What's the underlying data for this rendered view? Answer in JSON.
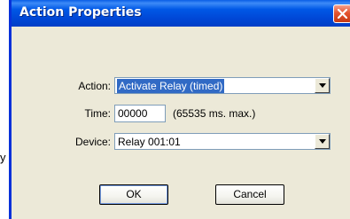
{
  "background_stray_char": "y",
  "window": {
    "title": "Action Properties"
  },
  "fields": {
    "action": {
      "label": "Action:",
      "value": "Activate Relay (timed)"
    },
    "time": {
      "label": "Time:",
      "value": "00000",
      "hint": "(65535 ms. max.)"
    },
    "device": {
      "label": "Device:",
      "value": "Relay 001:01"
    }
  },
  "buttons": {
    "ok": "OK",
    "cancel": "Cancel"
  },
  "colors": {
    "titlebar": "#0058e6",
    "dialog_bg": "#ece9d8",
    "selection": "#316ac5",
    "close_button": "#e5542e"
  },
  "icons": {
    "close": "close-icon",
    "dropdown": "chevron-down-icon"
  }
}
